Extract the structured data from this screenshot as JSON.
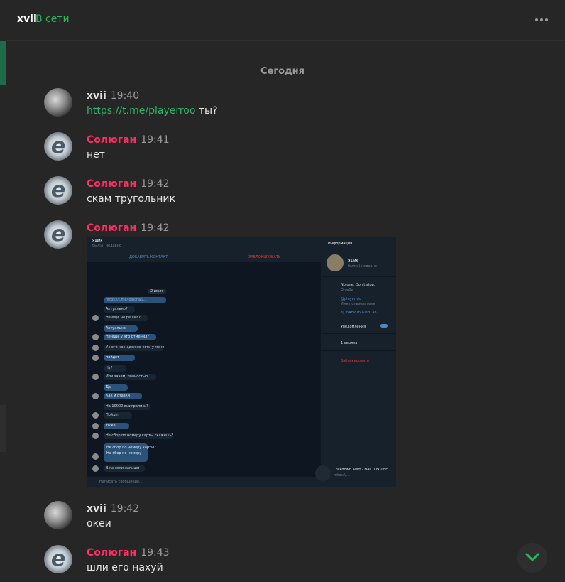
{
  "header": {
    "name": "xvii",
    "status": "В сети"
  },
  "date_divider": "Сегодня",
  "messages": [
    {
      "author": "xvii",
      "time": "19:40",
      "link": "https://t.me/playerroo",
      "text": " ты?"
    },
    {
      "author": "Солюган",
      "time": "19:41",
      "text": "нет"
    },
    {
      "author": "Солюган",
      "time": "19:42",
      "text": "скам тругольник"
    },
    {
      "author": "Солюган",
      "time": "19:42",
      "attachment": "screenshot"
    },
    {
      "author": "xvii",
      "time": "19:42",
      "text": "океи"
    },
    {
      "author": "Солюган",
      "time": "19:43",
      "text": "шли его нахуй"
    }
  ],
  "screenshot": {
    "chat_title": "Ящик",
    "chat_sub": "был(а) недавно",
    "add_contact": "ДОБАВИТЬ КОНТАКТ",
    "report": "ЗАБЛОКИРОВАТЬ",
    "date": "2 июля",
    "info_title": "Информация",
    "info_name": "Ящик",
    "info_sub": "был(а) недавно",
    "bio": "No one. Don't stop.",
    "bio_label": "О себе",
    "username": "@playerroo",
    "username_label": "Имя пользователя",
    "add_contact_2": "ДОБАВИТЬ КОНТАКТ",
    "notifications": "Уведомления",
    "links": "1 ссылка",
    "block": "Заблокировать",
    "bubbles": [
      "https://t.me/joinchat/...",
      "Актуально?",
      "Не ещё не решил?",
      "Актуально",
      "Не ещё у это отменил?",
      "У него на надежно есть у меня",
      "пойдет",
      "Ну?",
      "Или зачем, полностью",
      "Да",
      "Как и ставки",
      "На 10000 выигрались?",
      "Пойдет",
      "тоже",
      "Не сбор по номеру карты скажешь?",
      "Не сбор по номеру карты?",
      "Не сбор по номеру",
      "В ка если напиши"
    ],
    "placeholder": "Написать сообщение...",
    "bottom_preview_title": "Lockdown Alert - НАСТОЯЩЕЕ",
    "bottom_preview_sub": "https://..."
  },
  "colors": {
    "green": "#29b55a",
    "pink": "#ff2e63",
    "link": "#2fb56a",
    "bg": "#262626"
  }
}
